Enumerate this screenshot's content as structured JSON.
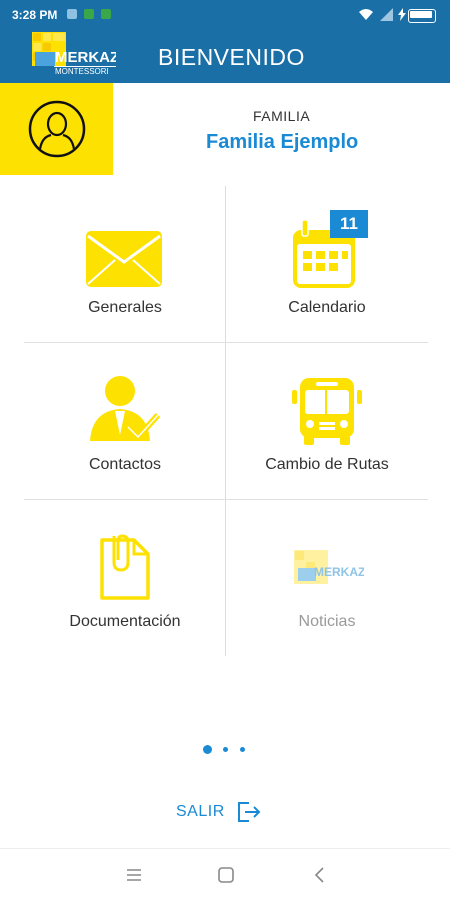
{
  "status_bar": {
    "time": "3:28 PM"
  },
  "app_bar": {
    "title": "BIENVENIDO",
    "logo_text": "MERKAZ",
    "logo_subtext": "MONTESSORI"
  },
  "profile": {
    "family_label": "FAMILIA",
    "family_name": "Familia Ejemplo"
  },
  "menu": [
    {
      "label": "Generales",
      "icon": "envelope-icon"
    },
    {
      "label": "Calendario",
      "icon": "calendar-icon",
      "badge": "11"
    },
    {
      "label": "Contactos",
      "icon": "contact-person-icon"
    },
    {
      "label": "Cambio de Rutas",
      "icon": "bus-icon"
    },
    {
      "label": "Documentación",
      "icon": "document-clip-icon"
    },
    {
      "label": "Noticias",
      "icon": "merkaz-logo-icon",
      "logo_text": "MERKAZ"
    }
  ],
  "pager": {
    "pages": 3,
    "active": 1
  },
  "logout": {
    "label": "SALIR"
  },
  "colors": {
    "primary": "#1a6fa6",
    "accent": "#fde100",
    "link": "#1a8ad4"
  }
}
